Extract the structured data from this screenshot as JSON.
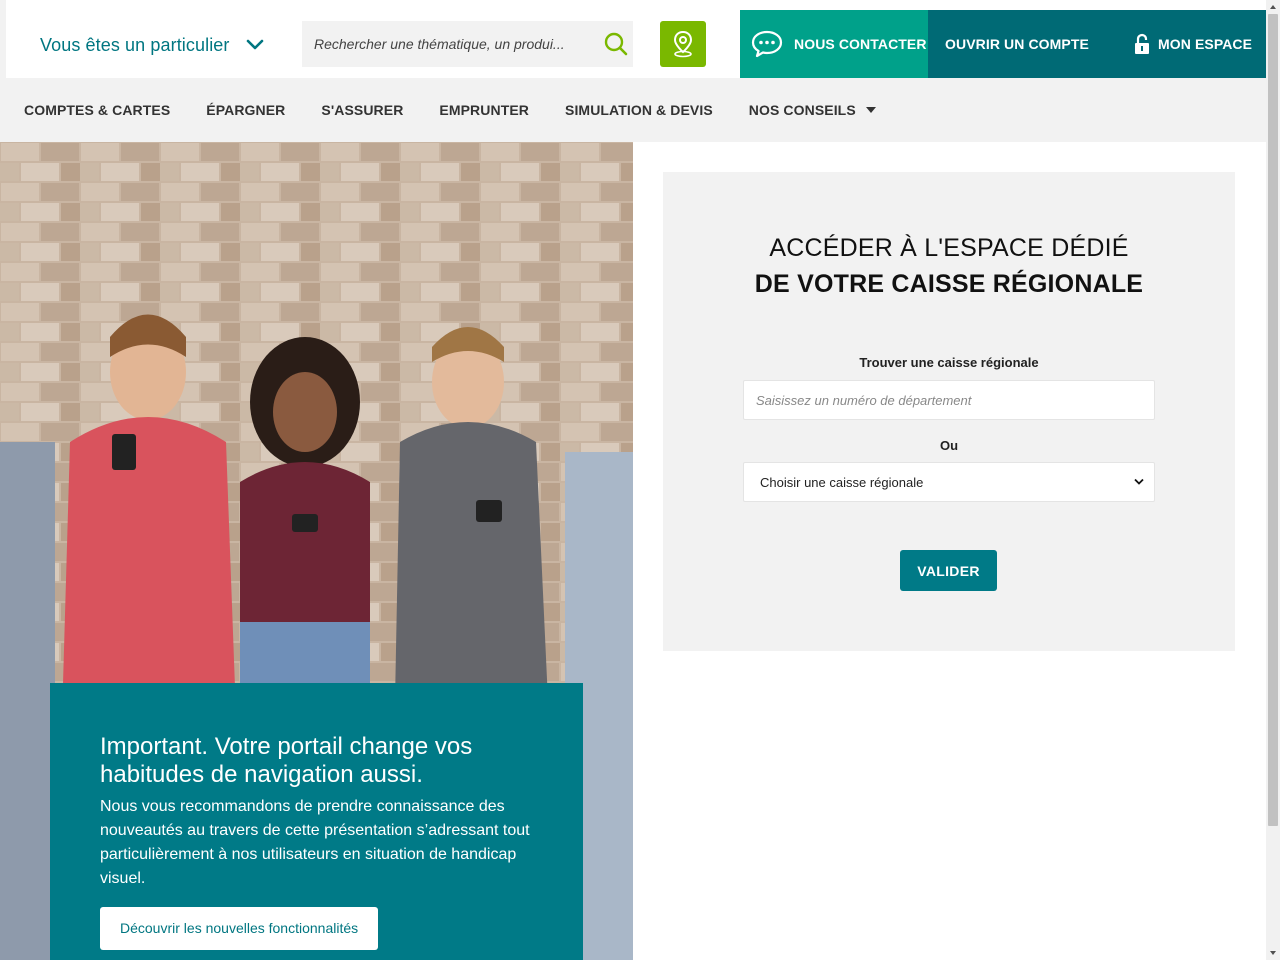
{
  "header": {
    "profile_label": "Vous êtes un particulier",
    "search_placeholder": "Rechercher une thématique, un produi...",
    "contact_label": "NOUS CONTACTER",
    "open_account_label": "OUVRIR UN COMPTE",
    "my_space_label": "MON ESPACE"
  },
  "nav": {
    "items": [
      {
        "label": "COMPTES & CARTES"
      },
      {
        "label": "ÉPARGNER"
      },
      {
        "label": "S'ASSURER"
      },
      {
        "label": "EMPRUNTER"
      },
      {
        "label": "SIMULATION & DEVIS"
      },
      {
        "label": "NOS CONSEILS"
      }
    ]
  },
  "hero": {
    "title": "Important. Votre portail change vos habitudes de navigation aussi.",
    "body": "Nous vous recommandons de prendre connaissance des nouveautés au travers de cette présentation s’adressant tout particulièrement à nos utilisateurs en situation de handicap visuel.",
    "button_label": "Découvrir les nouvelles fonctionnalités"
  },
  "regional": {
    "title_line1": "ACCÉDER À L'ESPACE DÉDIÉ",
    "title_line2": "DE VOTRE CAISSE RÉGIONALE",
    "find_label": "Trouver une caisse régionale",
    "dept_placeholder": "Saisissez un numéro de département",
    "or_label": "Ou",
    "select_value": "Choisir une caisse régionale",
    "validate_label": "VALIDER"
  },
  "colors": {
    "teal": "#007a87",
    "green_accent": "#00a18a",
    "dark_teal": "#006a75",
    "lime": "#7ab800"
  },
  "icons": {
    "profile": "chevron-down-icon",
    "search": "search-icon",
    "locator": "map-pin-icon",
    "contact": "chat-bubble-icon",
    "my_space": "lock-icon"
  }
}
